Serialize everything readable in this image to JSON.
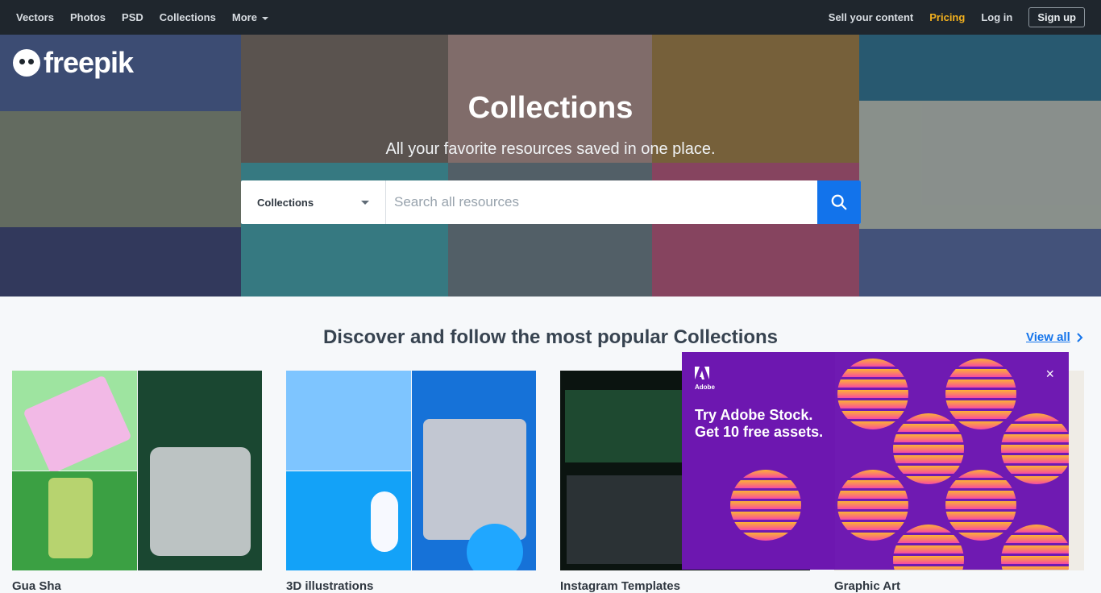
{
  "nav": {
    "left": [
      "Vectors",
      "Photos",
      "PSD",
      "Collections",
      "More"
    ],
    "sell": "Sell your content",
    "pricing": "Pricing",
    "login": "Log in",
    "signup": "Sign up"
  },
  "brand": {
    "name": "freepik"
  },
  "hero": {
    "title": "Collections",
    "subtitle": "All your favorite resources saved in one place.",
    "select_value": "Collections",
    "search_placeholder": "Search all resources"
  },
  "section": {
    "title": "Discover and follow the most popular Collections",
    "view_all": "View all"
  },
  "collections": [
    {
      "title": "Gua Sha"
    },
    {
      "title": "3D illustrations"
    },
    {
      "title": "Instagram Templates"
    },
    {
      "title": "Graphic Art"
    }
  ],
  "ad": {
    "brand": "Adobe",
    "headline": "Try Adobe Stock.",
    "subheadline": "Get 10 free assets.",
    "close_icon": "×"
  }
}
